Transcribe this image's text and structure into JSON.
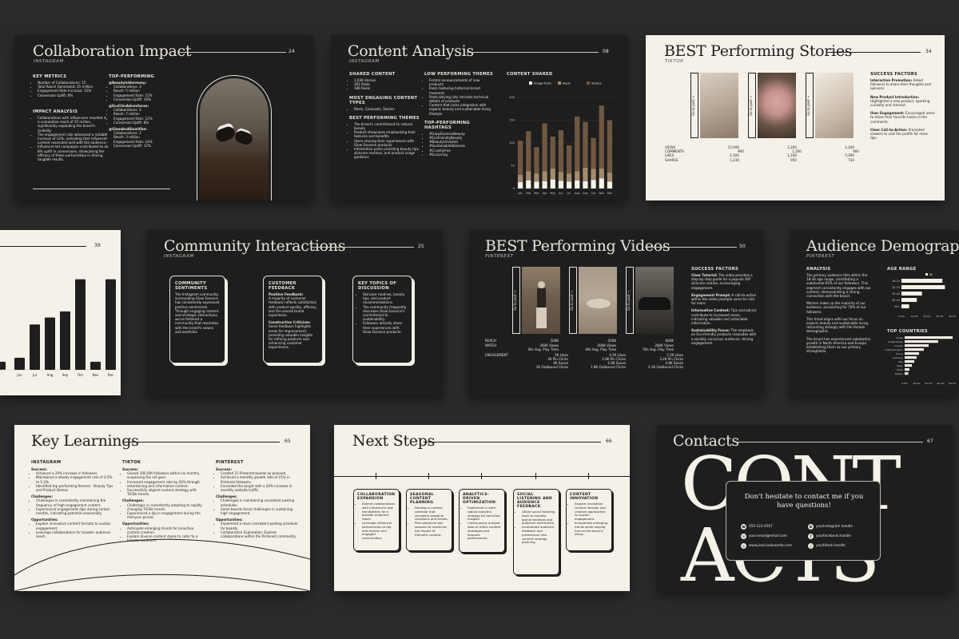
{
  "s1": {
    "title": "Collaboration Impact",
    "subtitle": "INSTAGRAM",
    "num": "24",
    "metrics_h": "KEY METRICS",
    "metrics": [
      "Number of Collaborations: 15",
      "Total Reach Generated: 25 million",
      "Engagement Rate Increase: 12%",
      "Conversion Uplift: 8%"
    ],
    "impact_h": "IMPACT ANALYSIS",
    "impact": [
      "Collaborations with influencers resulted in a cumulative reach of 25 million, significantly expanding the brand's visibility.",
      "The engagement rate witnessed a notable increase of 12%, indicating that influencer content resonated well with the audience.",
      "Influencer-led campaigns contributed to an 8% uplift in conversions, showcasing the efficacy of these partnerships in driving tangible results."
    ],
    "top_h": "TOP-PERFORMING",
    "top": [
      {
        "name": "@BeautyInHarmony:",
        "items": [
          "Collaborations: 3",
          "Reach: 5 million",
          "Engagement Rate: 15%",
          "Conversion Uplift: 10%"
        ]
      },
      {
        "name": "@EcoChicAdventures:",
        "items": [
          "Collaborations: 4",
          "Reach: 7 million",
          "Engagement Rate: 12%",
          "Conversion Uplift: 8%"
        ]
      },
      {
        "name": "@GlamAndGlowVibe:",
        "items": [
          "Collaborations: 2",
          "Reach: 3 million",
          "Engagement Rate: 14%",
          "Conversion Uplift: 12%"
        ]
      }
    ]
  },
  "s2": {
    "title": "Content Analysis",
    "subtitle": "INSTAGRAM",
    "num": "08",
    "shared_h": "SHARED CONTENT",
    "shared": [
      "1,036 Stories",
      "201 Posts",
      "186 Reels"
    ],
    "types_h": "MOST ENGAGING CONTENT TYPES",
    "types": [
      "Reels, Carousels, Stories"
    ],
    "best_h": "BEST PERFORMING THEMES",
    "best": [
      "The brand's commitment to natural beauty",
      "Product showcases emphasizing their features and benefits",
      "Users sharing their experiences with Glow Essence products",
      "Informative posts providing beauty tips, skincare routines, and product usage guidance"
    ],
    "low_h": "LOW PERFORMING THEMES",
    "low": [
      "Formal announcements of new products",
      "Posts featuring historical brand moments",
      "Posts delving into intricate technical details of products",
      "Content that lacks integration with organic beauty and sustainable living lifestyle"
    ],
    "hash_h": "TOP-PERFORMING HASHTAGS",
    "hash": [
      "#GlowEssenceBeauty",
      "#EcoFriendlyBeauty",
      "#BeautyUnveiled",
      "#SustainableSkincare",
      "#CrueltyFree",
      "#EcoLiving"
    ]
  },
  "chart_data": {
    "type": "bar",
    "title": "CONTENT SHARED",
    "categories": [
      "Jan",
      "Feb",
      "Mar",
      "Apr",
      "May",
      "Jun",
      "Jul",
      "Aug",
      "Sep",
      "Oct",
      "Nov",
      "Dec"
    ],
    "ylim": [
      0,
      200
    ],
    "yticks": [
      "200",
      "150",
      "100",
      "50",
      "0"
    ],
    "stacked": true,
    "series": [
      {
        "name": "Image Posts",
        "color": "#f4f1e8",
        "values": [
          14,
          18,
          15,
          16,
          20,
          17,
          15,
          18,
          16,
          19,
          22,
          15
        ]
      },
      {
        "name": "Reels",
        "color": "#a48a6a",
        "values": [
          16,
          20,
          18,
          22,
          24,
          19,
          18,
          20,
          30,
          24,
          22,
          20
        ]
      },
      {
        "name": "Stories",
        "color": "#6f5842",
        "values": [
          75,
          88,
          58,
          105,
          70,
          92,
          62,
          120,
          100,
          68,
          138,
          115
        ]
      }
    ]
  },
  "s3": {
    "title": "BEST Performing Stories",
    "subtitle": "TIKTOK",
    "num": "34",
    "goto": "Go to post →",
    "rows": [
      {
        "label": "VIEWS",
        "vals": [
          "15,000",
          "1,200",
          "1,200"
        ]
      },
      {
        "label": "COMMENTS",
        "vals": [
          "900",
          "1,200",
          "900"
        ]
      },
      {
        "label": "LIKES",
        "vals": [
          "1,500",
          "1,200",
          "5,000"
        ]
      },
      {
        "label": "SHARES",
        "vals": [
          "1,230",
          "950",
          "730"
        ]
      }
    ],
    "sf_h": "SUCCESS FACTORS",
    "sf": [
      {
        "b": "Interactive Promotion:",
        "t": " Asked followers to share their thoughts and opinions."
      },
      {
        "b": "New Product Introduction:",
        "t": " Highlighted a new product, sparking curiosity and interest."
      },
      {
        "b": "User Engagement:",
        "t": " Encouraged users to share their favorite hacks in the comments."
      },
      {
        "b": "Clear Call-to-Action:",
        "t": " Prompted viewers to visit the profile for more tips."
      }
    ]
  },
  "s4": {
    "num": "39",
    "chart_data": {
      "type": "bar",
      "categories": [
        "Jun",
        "Jul",
        "Aug",
        "Sep",
        "Oct",
        "Nov",
        "Dec"
      ],
      "values": [
        12,
        45,
        52,
        58,
        90,
        8,
        90
      ],
      "extra_left": [
        8
      ],
      "ylim": [
        0,
        100
      ]
    }
  },
  "s5": {
    "title": "Community Interactions",
    "subtitle": "INSTAGRAM",
    "num": "25",
    "c1_h": "COMMUNITY SENTIMENTS",
    "c1": "The Instagram community surrounding Glow Essence has consistently expressed positive sentiments. Through engaging content and strategic interactions, we've fostered a community that resonates with the brand's values and aesthetic.",
    "c2_h": "CUSTOMER FEEDBACK",
    "c2a_b": "Positive Feedback:",
    "c2a": "A majority of customer feedback reflects satisfaction with product quality, efficacy, and the overall brand experience.",
    "c2b_b": "Constructive Criticism:",
    "c2b": "Some feedback highlights areas for improvement, providing valuable insights for refining products and enhancing customer experiences.",
    "c3_h": "KEY TOPICS OF DISCUSSION",
    "c3": [
      "Skincare routines, beauty tips, and product recommendations.",
      "The community frequently discusses Glow Essence's commitment to sustainability.",
      "Followers actively share their experiences with Glow Essence products."
    ]
  },
  "s6": {
    "title": "BEST Performing Videos",
    "subtitle": "PINTEREST",
    "num": "50",
    "goto": "Go to post →",
    "reach_l": "REACH",
    "reach": [
      "500K",
      "450K",
      "660K"
    ],
    "watch_l": "WATCH",
    "watch": [
      "260K Views\n40s Avg. Play Time",
      "200K Views\n40s Avg. Play Time",
      "280K Views\n50s Avg. Play Time"
    ],
    "eng_l": "ENGAGEMENT",
    "eng": [
      "5K Likes\n3K Pin Clicks\n4K Saves\n2K Outbound Clicks",
      "4.5K Likes\n2.8K Pin Clicks\n2.9K Saves\n1.8K Outbound Clicks",
      "5.2K Likes\n3.2K Pin Clicks\n4.8K Saves\n2.3K Outbound Clicks"
    ],
    "sf_h": "SUCCESS FACTORS",
    "sf": [
      {
        "b": "Clear Tutorial:",
        "t": " The video provides a step-by-step guide for a popular DIY skincare routine, encouraging engagement."
      },
      {
        "b": "Engagement Prompt:",
        "t": " A call-to-action within the video prompts users to click for more."
      },
      {
        "b": "Informative Content:",
        "t": " Tips and advice contribute to increased saves, indicating valuable and actionable information."
      },
      {
        "b": "Sustainability Focus:",
        "t": " The emphasis on Eco-friendly products resonates with a socially conscious audience, driving engagement."
      }
    ]
  },
  "s7": {
    "title": "Audience Demographic",
    "subtitle": "PINTEREST",
    "analysis_h": "ANALYSIS",
    "analysis": [
      "The primary audience falls within the 18-34 age range, constituting a substantial 65% of our followers. This segment consistently engages with our content, demonstrating a strong connection with the brand.",
      "Women make up the majority of our audience, accounting for 70% of our followers.",
      "This trend aligns with our focus on organic beauty and sustainable living, resonating strongly with the female demographic.",
      "The brand has experienced substantial growth in North America and Europe, establishing them as our primary strongholds."
    ],
    "age_h": "AGE RANGE",
    "age_legend": "All",
    "age_cats": [
      "18-24",
      "25-34",
      "35-44",
      "45-54",
      "55+"
    ],
    "age_vals": [
      32,
      34,
      16,
      12,
      6
    ],
    "countries_h": "TOP COUNTRIES",
    "country_cats": [
      "Global",
      "United States",
      "Canada",
      "United Kingdom",
      "France",
      "Germany",
      "Italy",
      "Spain",
      "Brazil",
      "Nigeria"
    ],
    "country_vals": [
      40,
      28,
      20,
      16,
      12,
      10,
      8,
      6,
      4,
      3
    ],
    "xticks": [
      "0.0%",
      "10.0%",
      "20.0%",
      "30.0%",
      "40.0%"
    ]
  },
  "s8": {
    "title": "Key Learnings",
    "num": "65",
    "cols": [
      {
        "h": "INSTAGRAM",
        "sections": [
          {
            "t": "Success:",
            "items": [
              "Achieved a 20% increase in followers.",
              "Maintained a steady engagement rate of 4.5% to 5.2%.",
              "Identified top-performing themes - Beauty Tips and Product Demos"
            ]
          },
          {
            "t": "Challenges:",
            "items": [
              "Challenges in consistently maintaining the frequency of high-engagement content.",
              "Experienced engagement dips during certain months, indicating potential seasonality."
            ]
          },
          {
            "t": "Opportunities:",
            "items": [
              "Explore innovative content formats to sustain engagement.",
              "Leverage collaborations for broader audience reach."
            ]
          }
        ]
      },
      {
        "h": "TIKTOK",
        "sections": [
          {
            "t": "Success:",
            "items": [
              "Gained 100,000 followers within six months, surpassing the set goal.",
              "Increased engagement rate by 20% through entertaining and informative content.",
              "Successfully aligned content strategy with TikTok trends."
            ]
          },
          {
            "t": "Challenges:",
            "items": [
              "Challenges in consistently adapting to rapidly changing TikTok trends.",
              "Experienced a dip in engagement during the mid-year period."
            ]
          },
          {
            "t": "Opportunities:",
            "items": [
              "Anticipate emerging trends for proactive content creation.",
              "Explore diverse content styles to cater to a broader audience."
            ]
          }
        ]
      },
      {
        "h": "PINTEREST",
        "sections": [
          {
            "t": "Success:",
            "items": [
              "Created 15 Pinterest boards as planned.",
              "Achieved a monthly growth rate of 15% in Pinterest followers.",
              "Exceeded the target with a 20% increase in monthly website traffic."
            ]
          },
          {
            "t": "Challenges:",
            "items": [
              "Challenges in maintaining consistent posting schedules.",
              "Some boards faced challenges in sustaining high engagement."
            ]
          },
          {
            "t": "Opportunities:",
            "items": [
              "Implement a more consistent posting schedule for boards.",
              "Collaboration Exploration: Explore collaborations within the Pinterest community."
            ]
          }
        ]
      }
    ]
  },
  "s9": {
    "title": "Next Steps",
    "num": "66",
    "cards": [
      {
        "h": "COLLABORATION EXPANSION",
        "items": [
          "Extend collaborations with influencers and trendsetters for a broader audience reach.",
          "Leverage influencer partnerships to tap into diverse and engaged communities."
        ]
      },
      {
        "h": "SEASONAL CONTENT PLANNING",
        "items": [
          "Develop a content calendar that considers seasonal variations and trends.",
          "Plan ahead for key seasons to maximize the impact of thematic content."
        ]
      },
      {
        "h": "ANALYTICS-DRIVEN OPTIMIZATION",
        "items": [
          "Implement a more robust analytics strategy for real-time insights.",
          "Continuously analyze data to refine content strategies and improve performance."
        ]
      },
      {
        "h": "SOCIAL LISTENING AND AUDIENCE FEEDBACK",
        "items": [
          "Utilize social listening tools to monitor brand mentions and audience sentiments.",
          "Incorporate audience feedback and preferences into content strategy planning."
        ]
      },
      {
        "h": "CONTENT INNOVATION",
        "items": [
          "Explore innovative content formats and creative approaches to sustain engagement.",
          "Incorporate emerging trends while staying true to the brand's ethos."
        ]
      }
    ]
  },
  "s10": {
    "title": "Contacts",
    "num": "67",
    "big1": "CONT",
    "big2": "ACTS",
    "msg": "Don't hesitate to contact me if you have questions!",
    "phone": "555-123-4567",
    "email": "your.email@email.com",
    "web": "www.jessicaalonardo.com",
    "ig": "you/instagram.handle",
    "fb": "you/facebook.handle",
    "tt": "you/tiktok.handle"
  }
}
